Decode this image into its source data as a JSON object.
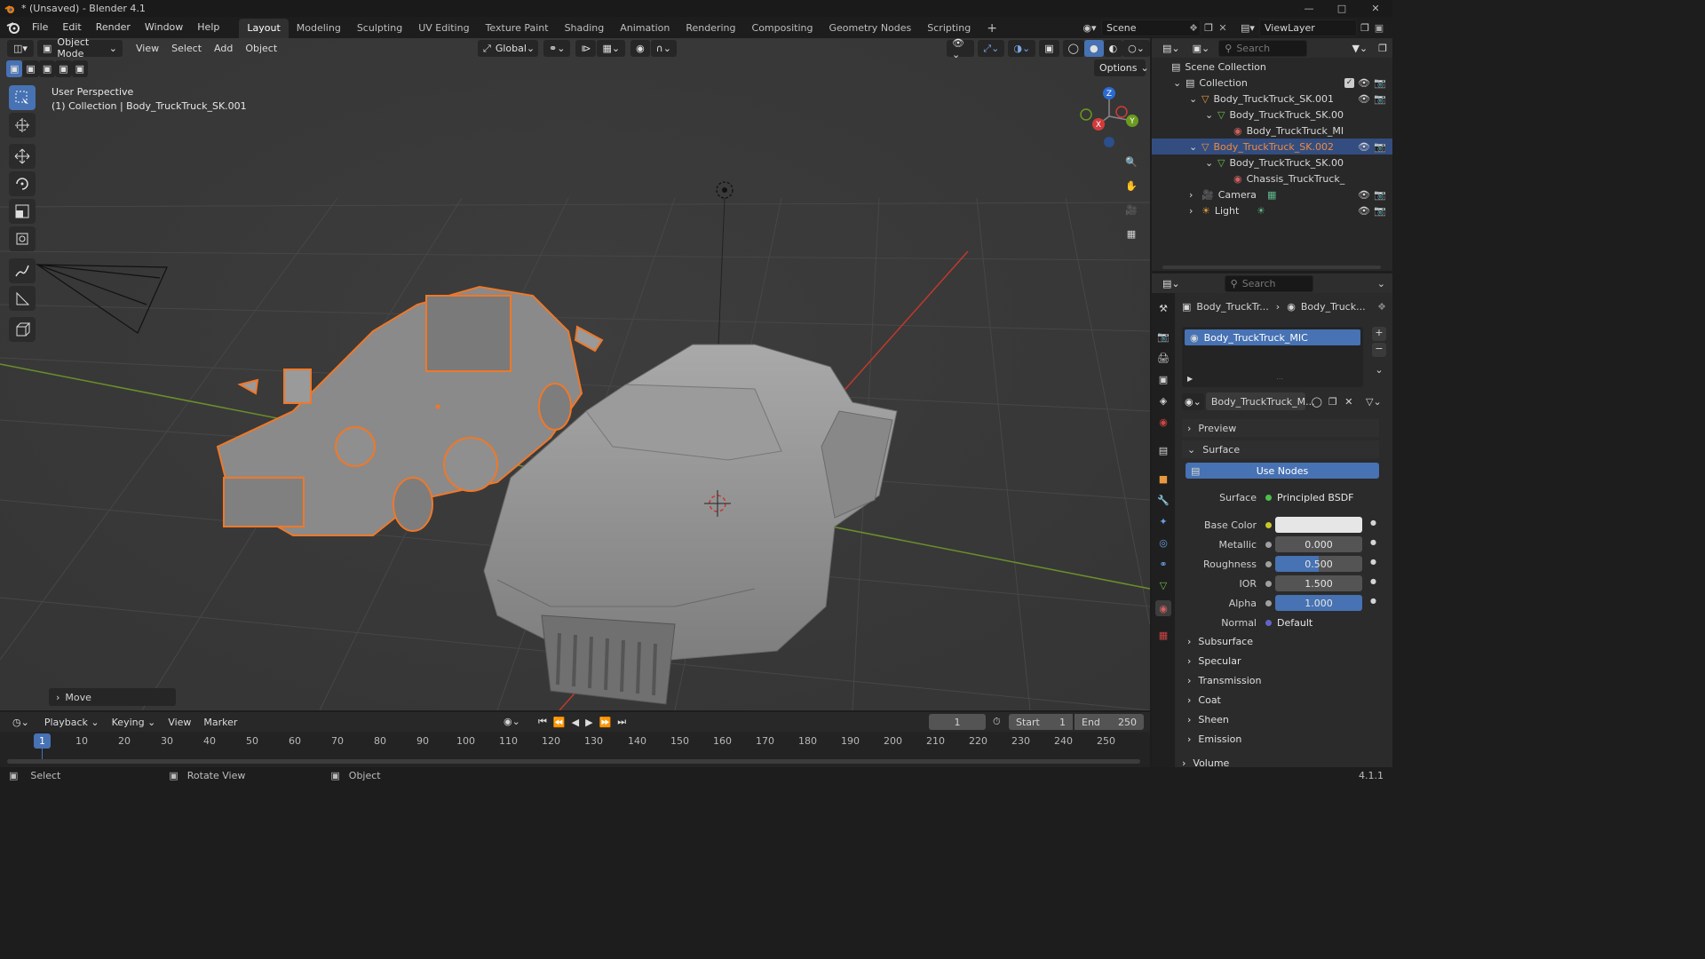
{
  "window": {
    "title": "* (Unsaved) - Blender 4.1",
    "version": "4.1.1"
  },
  "menus": [
    "File",
    "Edit",
    "Render",
    "Window",
    "Help"
  ],
  "workspaces": [
    "Layout",
    "Modeling",
    "Sculpting",
    "UV Editing",
    "Texture Paint",
    "Shading",
    "Animation",
    "Rendering",
    "Compositing",
    "Geometry Nodes",
    "Scripting"
  ],
  "active_workspace": "Layout",
  "scene": {
    "name": "Scene",
    "view_layer": "ViewLayer"
  },
  "viewport": {
    "mode": "Object Mode",
    "menus": [
      "View",
      "Select",
      "Add",
      "Object"
    ],
    "transform_orientation": "Global",
    "options_label": "Options",
    "perspective": "User Perspective",
    "context_line": "(1) Collection | Body_TruckTruck_SK.001",
    "last_op": "Move",
    "gizmo": {
      "z": "Z",
      "x": "X",
      "y": "Y"
    }
  },
  "outliner": {
    "search_placeholder": "Search",
    "root": "Scene Collection",
    "rows": [
      {
        "label": "Collection",
        "indent": 0
      },
      {
        "label": "Body_TruckTruck_SK.001",
        "indent": 1
      },
      {
        "label": "Body_TruckTruck_SK.00",
        "indent": 2
      },
      {
        "label": "Body_TruckTruck_MI",
        "indent": 3
      },
      {
        "label": "Body_TruckTruck_SK.002",
        "indent": 1
      },
      {
        "label": "Body_TruckTruck_SK.00",
        "indent": 2
      },
      {
        "label": "Chassis_TruckTruck_",
        "indent": 3
      },
      {
        "label": "Camera",
        "indent": 1
      },
      {
        "label": "Light",
        "indent": 1
      }
    ]
  },
  "properties": {
    "search_placeholder": "Search",
    "breadcrumb": [
      "Body_TruckTr...",
      "Body_Truck..."
    ],
    "slot": "Body_TruckTruck_MIC",
    "material": "Body_TruckTruck_M...",
    "panels": {
      "preview": "Preview",
      "surface": "Surface",
      "use_nodes": "Use Nodes"
    },
    "fields": [
      {
        "label": "Surface",
        "value": "Principled BSDF"
      },
      {
        "label": "Base Color",
        "value": ""
      },
      {
        "label": "Metallic",
        "value": "0.000"
      },
      {
        "label": "Roughness",
        "value": "0.500"
      },
      {
        "label": "IOR",
        "value": "1.500"
      },
      {
        "label": "Alpha",
        "value": "1.000"
      },
      {
        "label": "Normal",
        "value": "Default"
      }
    ],
    "subpanels": [
      "Subsurface",
      "Specular",
      "Transmission",
      "Coat",
      "Sheen",
      "Emission",
      "Volume"
    ]
  },
  "timeline": {
    "menus": [
      "Playback",
      "Keying",
      "View",
      "Marker"
    ],
    "current_frame": "1",
    "start_label": "Start",
    "start": "1",
    "end_label": "End",
    "end": "250",
    "ticks": [
      "1",
      "10",
      "20",
      "30",
      "40",
      "50",
      "60",
      "70",
      "80",
      "90",
      "100",
      "110",
      "120",
      "130",
      "140",
      "150",
      "160",
      "170",
      "180",
      "190",
      "200",
      "210",
      "220",
      "230",
      "240",
      "250"
    ]
  },
  "status": {
    "select": "Select",
    "rotate": "Rotate View",
    "object": "Object"
  },
  "colors": {
    "accent": "#4772b3",
    "selected_outline": "#f07828",
    "axis_x": "#c0392b",
    "axis_y": "#6b8f2a",
    "gizmo_z": "#2a6bd1"
  }
}
